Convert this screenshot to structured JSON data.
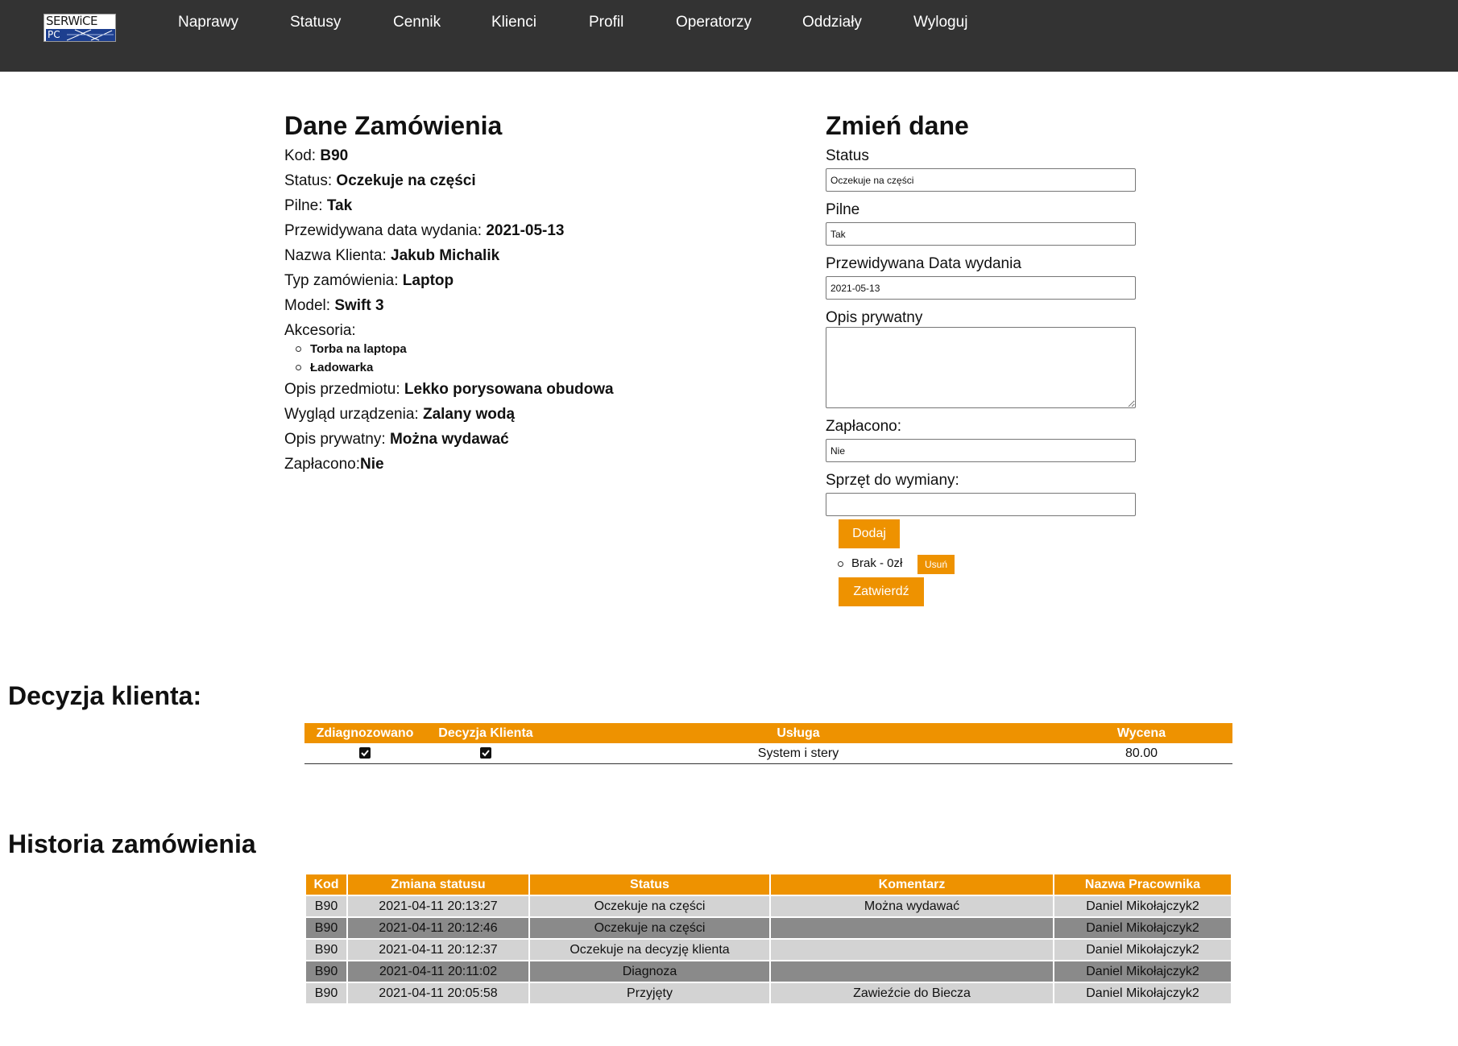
{
  "nav": {
    "logo": {
      "top_text": "SERWiCE",
      "bottom_text": "PC"
    },
    "links": [
      "Naprawy",
      "Statusy",
      "Cennik",
      "Klienci",
      "Profil",
      "Operatorzy",
      "Oddziały",
      "Wyloguj"
    ]
  },
  "order": {
    "title": "Dane Zamówienia",
    "code_label": "Kod: ",
    "code": "B90",
    "status_label": "Status: ",
    "status": "Oczekuje na części",
    "urgent_label": "Pilne: ",
    "urgent": "Tak",
    "date_label": "Przewidywana data wydania: ",
    "date": "2021-05-13",
    "client_label": "Nazwa Klienta: ",
    "client": "Jakub Michalik",
    "type_label": "Typ zamówienia: ",
    "type": "Laptop",
    "model_label": "Model: ",
    "model": "Swift 3",
    "accessories_label": "Akcesoria:",
    "accessories": [
      "Torba na laptopa",
      "Ładowarka"
    ],
    "item_desc_label": "Opis przedmiotu: ",
    "item_desc": "Lekko porysowana obudowa",
    "appearance_label": "Wygląd urządzenia: ",
    "appearance": "Zalany wodą",
    "private_desc_label": "Opis prywatny: ",
    "private_desc": "Można wydawać",
    "paid_label": "Zapłacono:",
    "paid": "Nie"
  },
  "form": {
    "title": "Zmień dane",
    "status_label": "Status",
    "status_value": "Oczekuje na części",
    "urgent_label": "Pilne",
    "urgent_value": "Tak",
    "date_label": "Przewidywana Data wydania",
    "date_value": "2021-05-13",
    "private_label": "Opis prywatny",
    "private_value": "",
    "paid_label": "Zapłacono:",
    "paid_value": "Nie",
    "parts_label": "Sprzęt do wymiany:",
    "parts_value": "",
    "add_button": "Dodaj",
    "part_item": "Brak - 0zł",
    "remove_button": "Usuń",
    "submit_button": "Zatwierdź"
  },
  "decision": {
    "title": "Decyzja klienta:",
    "headers": [
      "Zdiagnozowano",
      "Decyzja Klienta",
      "Usługa",
      "Wycena"
    ],
    "row": {
      "diagnosed": true,
      "decision": true,
      "service": "System i stery",
      "price": "80.00"
    }
  },
  "history": {
    "title": "Historia zamówienia",
    "headers": [
      "Kod",
      "Zmiana statusu",
      "Status",
      "Komentarz",
      "Nazwa Pracownika"
    ],
    "rows": [
      [
        "B90",
        "2021-04-11 20:13:27",
        "Oczekuje na części",
        "Można wydawać",
        "Daniel Mikołajczyk2"
      ],
      [
        "B90",
        "2021-04-11 20:12:46",
        "Oczekuje na części",
        "",
        "Daniel Mikołajczyk2"
      ],
      [
        "B90",
        "2021-04-11 20:12:37",
        "Oczekuje na decyzję klienta",
        "",
        "Daniel Mikołajczyk2"
      ],
      [
        "B90",
        "2021-04-11 20:11:02",
        "Diagnoza",
        "",
        "Daniel Mikołajczyk2"
      ],
      [
        "B90",
        "2021-04-11 20:05:58",
        "Przyjęty",
        "Zawieźcie do Biecza",
        "Daniel Mikołajczyk2"
      ]
    ]
  },
  "colors": {
    "nav_bg": "#333333",
    "accent": "#ee9200",
    "row_light": "#d3d3d3",
    "row_dark": "#8a8a8a"
  }
}
